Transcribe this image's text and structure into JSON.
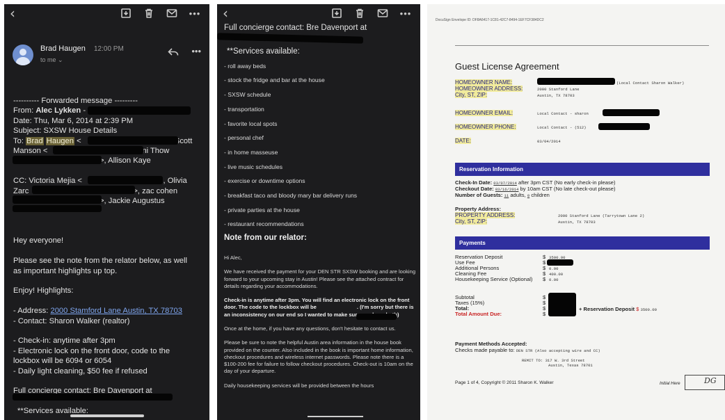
{
  "email": {
    "sender": "Brad Haugen",
    "time": "12:00 PM",
    "to_me": "to me ⌄",
    "lines": {
      "forwarded": "---------- Forwarded message ---------",
      "from_label": "From: ",
      "from_name": "Alec Lykken",
      "from_rest": " -",
      "date": "Date: Thu, Mar 6, 2014 at 2:39 PM",
      "subject": "Subject: SXSW House Details",
      "to_label": "To: ",
      "to_hl1": "Brad",
      "to_hl2": "Haugen",
      "to_lt": " <",
      "to_scott": ", Scott",
      "manson": "Manson <",
      "penni": "Penni Thow",
      "allison": ">, Allison Kaye",
      "cc_label": "CC: Victoria Mejia <",
      "olivia": ">, Olivia",
      "zarc": "Zarc",
      "zac": ">, zac cohen",
      "jackie": ">, Jackie Augustus",
      "hey": "Hey everyone!",
      "please1": "Please see the note from the relator below, as well",
      "please2": "as important highlights up top.",
      "enjoy": "Enjoy! Highlights:",
      "addr_label": "- Address: ",
      "addr_link": "2000 Stamford Lane Austin, TX 78703",
      "contact": "- Contact: Sharon Walker (realtor)",
      "checkin": "- Check-in: anytime after 3pm",
      "lock1": "- Electronic lock on the front door, code to the",
      "lock2": "lockbox will be 6094 or 6054",
      "cleaning": "- Daily light cleaning, $50 fee if refused",
      "concierge": "Full concierge contact: Bre Davenport at",
      "services": "**Services available:"
    }
  },
  "continued": {
    "head": "Full concierge contact: Bre Davenport at",
    "services_title": "**Services available:",
    "services": [
      "- roll away beds",
      "- stock the fridge and bar at the house",
      "- SXSW schedule",
      "- transportation",
      "- favorite local spots",
      "- personal chef",
      "- in home masseuse",
      "- live music schedules",
      "- exercise or downtime options",
      "- breakfast taco and bloody mary bar delivery runs",
      "- private parties at the house",
      "- restaurant recommendations"
    ],
    "note_title": "Note from our relator:",
    "hi": "Hi Alec,",
    "para1": "We have received the payment for your DEN STR SXSW booking and are looking forward to your upcoming stay in Austin! Please see the attached contract for details regarding your accommodations.",
    "para2a": "Check-in is anytime after 3pm. You will find an electronic lock on the front door. The code to the lockbox will be",
    "para2b": ". (I'm sorry but there is an inconsistency on our end so I wanted to make sure you have both)",
    "para3": "Once at the home, if you have any questions, don't hesitate to contact us.",
    "para4": "Please be sure to note the helpful Austin area information in the house book provided on the counter. Also included in the book is important home information, checkout procedures and wireless internet passwords. Please note there is a $100-200 fee for failure to follow checkout procedures. Check-out is 10am on the day of your departure.",
    "para5": "Daily housekeeping services will be provided between the hours"
  },
  "contract": {
    "envelope_id": "DocuSign Envelope ID: DF8A6417-1C81-42C7-8494-1EF7CF384DC2",
    "title": "Guest License Agreement",
    "homeowner_name_label": "HOMEOWNER NAME:",
    "homeowner_address_label": "HOMEOWNER ADDRESS:",
    "city_label": "City, ST, ZIP:",
    "local_contact": "(Local Contact Sharon Walker)",
    "address_val": "2000 Stanford Lane",
    "city_val": "Austin, TX 78703",
    "email_label": "HOMEOWNER EMAIL:",
    "email_val": "Local Contact - sharon",
    "phone_label": "HOMEOWNER PHONE:",
    "phone_val": "Local Contact - (512)",
    "date_label": "DATE:",
    "date_val": "03/04/2014",
    "reservation_header": "Reservation Information",
    "checkin_label": "Check-In Date:",
    "checkin_val": "03/07/2014",
    "checkin_note": "after 3pm CST (No early check-in please)",
    "checkout_label": "Checkout Date:",
    "checkout_val": "03/16/2014",
    "checkout_note": "by 10am CST (No late check-out please)",
    "guests_label": "Number of Guests:",
    "guests_adults": "11",
    "guests_adults_word": "adults,",
    "guests_children": "0",
    "guests_children_word": "children",
    "prop_label": "Property Address:",
    "prop_addr_label": "PROPERTY ADDRESS:",
    "prop_city_label": "City, ST, ZIP:",
    "prop_addr_val": "2000 Stanford Lane (Tarrytown Lane 2)",
    "prop_city_val": "Austin, TX 78703",
    "payments_header": "Payments",
    "res_deposit": "Reservation Deposit",
    "use_fee": "Use Fee",
    "add_persons": "Additional Persons",
    "cleaning_fee": "Cleaning Fee",
    "housekeeping": "Housekeeping Service (Optional)",
    "dollar": "$",
    "res_deposit_val": "3500.00",
    "add_persons_val": "0.00",
    "cleaning_val": "400.00",
    "housekeeping_val": "0.00",
    "subtotal": "Subtotal",
    "taxes": "Taxes (15%)",
    "total": "Total:",
    "total_due": "Total Amount Due:",
    "plus_deposit": "+ Reservation Deposit",
    "plus_deposit_val": "3500.00",
    "methods": "Payment Methods Accepted:",
    "checks": "Checks made payable to:",
    "checks_val": "DEN STR (Also accepting wire and CC)",
    "remit1": "REMIT TO: 317 W. 3rd Street",
    "remit2": "Austin, Texas 78701",
    "footer": "Page 1 of 4, Copyright © 2011 Sharon K. Walker",
    "initial": "Initial Here",
    "initials_mark": "DG"
  }
}
